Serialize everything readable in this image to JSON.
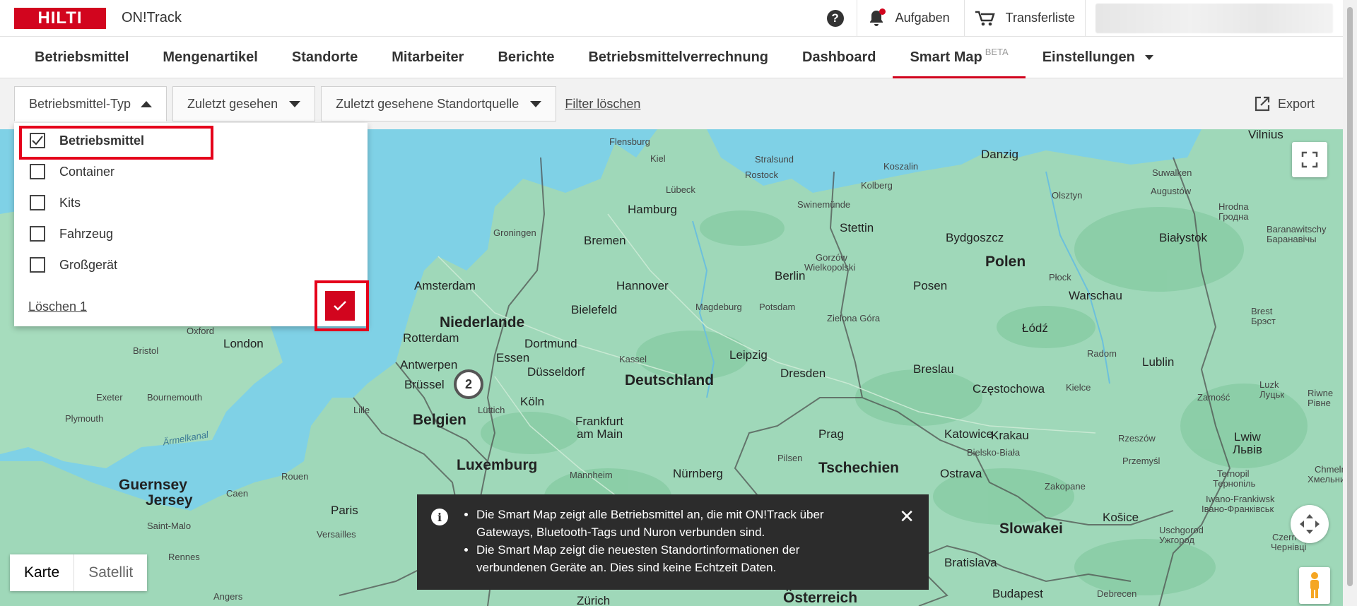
{
  "header": {
    "logo_text": "HILTI",
    "app_title": "ON!Track",
    "help_icon": "question-circle-icon",
    "tasks_label": "Aufgaben",
    "transfer_label": "Transferliste",
    "brand_color": "#d2051e"
  },
  "nav": {
    "items": [
      {
        "label": "Betriebsmittel"
      },
      {
        "label": "Mengenartikel"
      },
      {
        "label": "Standorte"
      },
      {
        "label": "Mitarbeiter"
      },
      {
        "label": "Berichte"
      },
      {
        "label": "Betriebsmittelverrechnung"
      },
      {
        "label": "Dashboard"
      },
      {
        "label": "Smart Map",
        "badge": "BETA",
        "active": true
      },
      {
        "label": "Einstellungen"
      }
    ]
  },
  "filters": {
    "type_label": "Betriebsmittel-Typ",
    "last_seen_label": "Zuletzt gesehen",
    "location_source_label": "Zuletzt gesehene Standortquelle",
    "clear_label": "Filter löschen",
    "export_label": "Export"
  },
  "dropdown": {
    "options": [
      {
        "label": "Betriebsmittel",
        "checked": true
      },
      {
        "label": "Container",
        "checked": false
      },
      {
        "label": "Kits",
        "checked": false
      },
      {
        "label": "Fahrzeug",
        "checked": false
      },
      {
        "label": "Großgerät",
        "checked": false
      }
    ],
    "clear_label": "Löschen 1"
  },
  "map": {
    "cluster_count": "2",
    "maptype": {
      "map": "Karte",
      "satellite": "Satellit"
    },
    "labels": {
      "flensburg": "Flensburg",
      "kiel": "Kiel",
      "stralsund": "Stralsund",
      "rostock": "Rostock",
      "luebeck": "Lübeck",
      "koszalin": "Koszalin",
      "kolberg": "Kolberg",
      "danzig": "Danzig",
      "vilnius": "Vilnius",
      "suwalken": "Suwalken",
      "augustow": "Augustów",
      "olsztyn": "Olsztyn",
      "swinemuende": "Swinemünde",
      "hamburg": "Hamburg",
      "stettin": "Stettin",
      "hrodna": "Hrodna",
      "hrodna_cyr": "Гродна",
      "groningen": "Groningen",
      "bremen": "Bremen",
      "bydgoszcz": "Bydgoszcz",
      "bialystok": "Białystok",
      "baranawitschy": "Baranawitschy",
      "baranawitschy_cyr": "Баранавічы",
      "gorzow": "Gorzów",
      "wielkopolski": "Wielkopolski",
      "polen": "Polen",
      "amsterdam": "Amsterdam",
      "hannover": "Hannover",
      "berlin": "Berlin",
      "posen": "Posen",
      "plock": "Płock",
      "warschau": "Warschau",
      "magdeburg": "Magdeburg",
      "potsdam": "Potsdam",
      "bielefeld": "Bielefeld",
      "niederlande": "Niederlande",
      "brest": "Brest",
      "brest_cyr": "Брэст",
      "zielona_gora": "Zielona Góra",
      "lodz": "Łódź",
      "oxford": "Oxford",
      "london": "London",
      "rotterdam": "Rotterdam",
      "dortmund": "Dortmund",
      "bristol": "Bristol",
      "antwerpen": "Antwerpen",
      "essen": "Essen",
      "kassel": "Kassel",
      "leipzig": "Leipzig",
      "radom": "Radom",
      "lublin": "Lublin",
      "breslau": "Breslau",
      "duesseldorf": "Düsseldorf",
      "bruessel": "Brüssel",
      "dresden": "Dresden",
      "deutschland": "Deutschland",
      "exeter": "Exeter",
      "bournemouth": "Bournemouth",
      "koeln": "Köln",
      "lille": "Lille",
      "luettich": "Lüttich",
      "czestochowa": "Częstochowa",
      "kielce": "Kielce",
      "luzk": "Luzk",
      "luzk_cyr": "Луцьк",
      "zamosc": "Zamość",
      "riwne": "Riwne",
      "riwne_cyr": "Рівне",
      "plymouth": "Plymouth",
      "belgien": "Belgien",
      "frankfurt": "Frankfurt",
      "am_main": "am Main",
      "prag": "Prag",
      "katowice": "Katowice",
      "rzeszow": "Rzeszów",
      "krakau": "Krakau",
      "lwiw": "Lwiw",
      "lwiw_cyr": "Львів",
      "aermelkanal": "Ärmelkanal",
      "bielsko": "Bielsko-Biała",
      "pilsen": "Pilsen",
      "tschechien": "Tschechien",
      "luxemburg": "Luxemburg",
      "przemysl": "Przemyśl",
      "chmelni": "Chmelni",
      "chmelni_cyr": "Хмельни",
      "mannheim": "Mannheim",
      "nuernberg": "Nürnberg",
      "ostrava": "Ostrava",
      "zakopane": "Zakopane",
      "ternopil": "Ternopil",
      "ternopil_cyr": "Тернопіль",
      "guernsey": "Guernsey",
      "jersey": "Jersey",
      "rouen": "Rouen",
      "caen": "Caen",
      "iwano": "Iwano-Frankiwsk",
      "iwano_cyr": "Івано-Франківськ",
      "paris": "Paris",
      "versailles": "Versailles",
      "kosice": "Košice",
      "saint_malo": "Saint-Malo",
      "slowakei": "Slowakei",
      "uschgorod": "Uschgorod",
      "uschgorod_cyr": "Ужгород",
      "czern": "Czern",
      "czern_cyr": "Чернівці",
      "rennes": "Rennes",
      "bratislava": "Bratislava",
      "angers": "Angers",
      "zuerich": "Zürich",
      "oesterreich": "Österreich",
      "budapest": "Budapest",
      "debrecen": "Debrecen"
    }
  },
  "toast": {
    "icon": "info-icon",
    "line1": "Die Smart Map zeigt alle Betriebsmittel an, die mit ON!Track über Gateways, Bluetooth-Tags und Nuron verbunden sind.",
    "line2": "Die Smart Map zeigt die neuesten Standortinformationen der verbundenen Geräte an. Dies sind keine Echtzeit Daten.",
    "close_icon": "close-icon"
  }
}
